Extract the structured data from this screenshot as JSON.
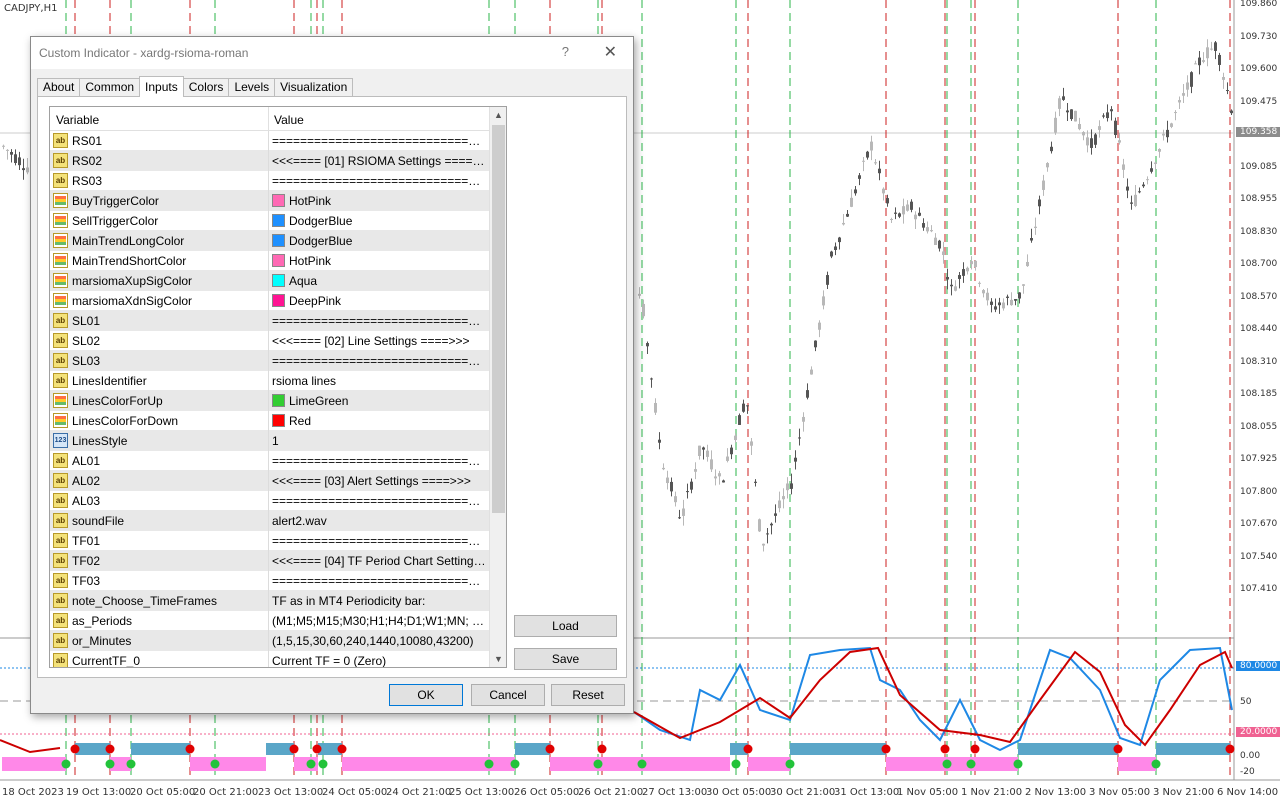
{
  "chart": {
    "symbol": "CADJPY,H1",
    "price_labels": [
      "109.860",
      "109.730",
      "109.600",
      "109.475",
      "109.215",
      "109.085",
      "108.955",
      "108.830",
      "108.700",
      "108.570",
      "108.440",
      "108.310",
      "108.185",
      "108.055",
      "107.925",
      "107.800",
      "107.670",
      "107.540",
      "107.410"
    ],
    "current_price": "109.358",
    "indicator_labels": [
      "80.0000",
      "50",
      "20.0000",
      "0.00",
      "-20"
    ],
    "time_labels": [
      "18 Oct 2023",
      "19 Oct 13:00",
      "20 Oct 05:00",
      "20 Oct 21:00",
      "23 Oct 13:00",
      "24 Oct 05:00",
      "24 Oct 21:00",
      "25 Oct 13:00",
      "26 Oct 05:00",
      "26 Oct 21:00",
      "27 Oct 13:00",
      "30 Oct 05:00",
      "30 Oct 21:00",
      "31 Oct 13:00",
      "1 Nov 05:00",
      "1 Nov 21:00",
      "2 Nov 13:00",
      "3 Nov 05:00",
      "3 Nov 21:00",
      "6 Nov 14:00"
    ],
    "colors": {
      "up": "#2bb54a",
      "down": "#cc1f1f",
      "rsi": "#1e88e5",
      "signal": "#cc0000",
      "bar_blue": "#5aa6c8",
      "bar_pink": "#ff88e8"
    }
  },
  "dialog": {
    "title": "Custom Indicator - xardg-rsioma-roman",
    "help": "?",
    "close": "✕",
    "tabs": [
      "About",
      "Common",
      "Inputs",
      "Colors",
      "Levels",
      "Visualization"
    ],
    "active_tab": "Inputs",
    "columns": {
      "variable": "Variable",
      "value": "Value"
    },
    "rows": [
      {
        "icon": "ab",
        "var": "RS01",
        "val": "====================================="
      },
      {
        "icon": "ab",
        "var": "RS02",
        "val": "<<<==== [01] RSIOMA Settings ====>>>"
      },
      {
        "icon": "ab",
        "var": "RS03",
        "val": "====================================="
      },
      {
        "icon": "col",
        "var": "BuyTriggerColor",
        "val": "HotPink",
        "swatch": "#ff69b4"
      },
      {
        "icon": "col",
        "var": "SellTriggerColor",
        "val": "DodgerBlue",
        "swatch": "#1e90ff"
      },
      {
        "icon": "col",
        "var": "MainTrendLongColor",
        "val": "DodgerBlue",
        "swatch": "#1e90ff"
      },
      {
        "icon": "col",
        "var": "MainTrendShortColor",
        "val": "HotPink",
        "swatch": "#ff69b4"
      },
      {
        "icon": "col",
        "var": "marsiomaXupSigColor",
        "val": "Aqua",
        "swatch": "#00ffff"
      },
      {
        "icon": "col",
        "var": "marsiomaXdnSigColor",
        "val": "DeepPink",
        "swatch": "#ff1493"
      },
      {
        "icon": "ab",
        "var": "SL01",
        "val": "====================================="
      },
      {
        "icon": "ab",
        "var": "SL02",
        "val": "<<<==== [02] Line Settings ====>>>"
      },
      {
        "icon": "ab",
        "var": "SL03",
        "val": "====================================="
      },
      {
        "icon": "ab",
        "var": "LinesIdentifier",
        "val": "rsioma lines"
      },
      {
        "icon": "col",
        "var": "LinesColorForUp",
        "val": "LimeGreen",
        "swatch": "#32cd32"
      },
      {
        "icon": "col",
        "var": "LinesColorForDown",
        "val": "Red",
        "swatch": "#ff0000"
      },
      {
        "icon": "num",
        "var": "LinesStyle",
        "val": "1"
      },
      {
        "icon": "ab",
        "var": "AL01",
        "val": "====================================="
      },
      {
        "icon": "ab",
        "var": "AL02",
        "val": "<<<==== [03] Alert Settings ====>>>"
      },
      {
        "icon": "ab",
        "var": "AL03",
        "val": "====================================="
      },
      {
        "icon": "ab",
        "var": "soundFile",
        "val": "alert2.wav"
      },
      {
        "icon": "ab",
        "var": "TF01",
        "val": "====================================="
      },
      {
        "icon": "ab",
        "var": "TF02",
        "val": "<<<==== [04] TF Period Chart Settings ====>>>"
      },
      {
        "icon": "ab",
        "var": "TF03",
        "val": "====================================="
      },
      {
        "icon": "ab",
        "var": "note_Choose_TimeFrames",
        "val": "TF as in MT4 Periodicity bar:"
      },
      {
        "icon": "ab",
        "var": "as_Periods",
        "val": "(M1;M5;M15;M30;H1;H4;D1;W1;MN; or:)"
      },
      {
        "icon": "ab",
        "var": "or_Minutes",
        "val": "(1,5,15,30,60,240,1440,10080,43200)"
      },
      {
        "icon": "ab",
        "var": "CurrentTF_0",
        "val": "Current TF = 0 (Zero)"
      }
    ],
    "buttons": {
      "load": "Load",
      "save": "Save",
      "ok": "OK",
      "cancel": "Cancel",
      "reset": "Reset"
    }
  }
}
